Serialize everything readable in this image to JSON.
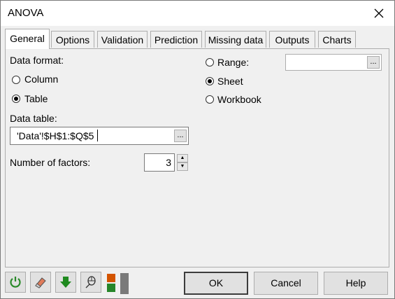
{
  "window": {
    "title": "ANOVA"
  },
  "tabs": [
    "General",
    "Options",
    "Validation",
    "Prediction",
    "Missing data",
    "Outputs",
    "Charts"
  ],
  "general": {
    "data_format_label": "Data format:",
    "format_options": {
      "column": "Column",
      "table": "Table"
    },
    "selected_format": "Table",
    "data_table_label": "Data table:",
    "data_table_value": "'Data'!$H$1:$Q$5",
    "factors_label": "Number of factors:",
    "factors_value": "3",
    "output_options": {
      "range": "Range:",
      "sheet": "Sheet",
      "workbook": "Workbook"
    },
    "selected_output": "Sheet",
    "range_value": ""
  },
  "buttons": {
    "ok": "OK",
    "cancel": "Cancel",
    "help": "Help"
  },
  "ellipsis": "...",
  "colors": {
    "reset_icon": "#2a8a2a",
    "download_icon": "#1f8a1f",
    "toggle_top": "#d35400",
    "toggle_bottom": "#27862a"
  }
}
